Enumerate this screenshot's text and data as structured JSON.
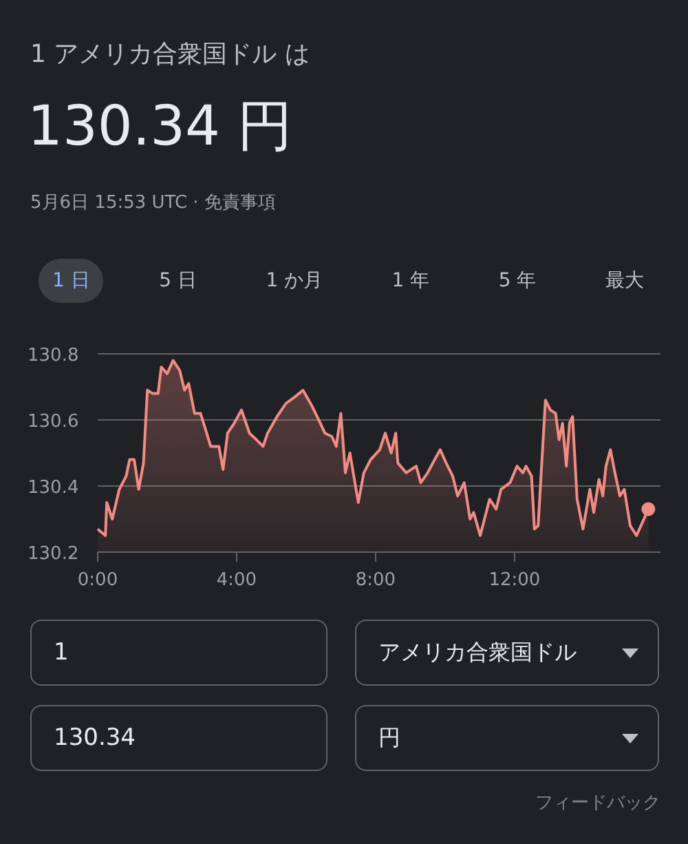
{
  "header": {
    "title": "1 アメリカ合衆国ドル は",
    "rate": "130.34 円",
    "timestamp": "5月6日 15:53 UTC · ",
    "disclaimer": "免責事項"
  },
  "ranges": [
    {
      "label": "1 日",
      "selected": true
    },
    {
      "label": "5 日",
      "selected": false
    },
    {
      "label": "1 か月",
      "selected": false
    },
    {
      "label": "1 年",
      "selected": false
    },
    {
      "label": "5 年",
      "selected": false
    },
    {
      "label": "最大",
      "selected": false
    }
  ],
  "chart": {
    "chart_data": {
      "type": "area",
      "xlim": [
        0,
        16.2
      ],
      "ylim": [
        130.2,
        130.8
      ],
      "xticks": [
        {
          "value": 0,
          "label": "0:00"
        },
        {
          "value": 4,
          "label": "4:00"
        },
        {
          "value": 8,
          "label": "8:00"
        },
        {
          "value": 12,
          "label": "12:00"
        }
      ],
      "yticks": [
        {
          "value": 130.2,
          "label": "130.2"
        },
        {
          "value": 130.4,
          "label": "130.4"
        },
        {
          "value": 130.6,
          "label": "130.6"
        },
        {
          "value": 130.8,
          "label": "130.8"
        }
      ],
      "x": [
        0,
        0.22,
        0.26,
        0.42,
        0.62,
        0.82,
        0.92,
        1.05,
        1.18,
        1.32,
        1.43,
        1.58,
        1.74,
        1.83,
        2.0,
        2.17,
        2.36,
        2.5,
        2.62,
        2.79,
        2.96,
        3.05,
        3.25,
        3.49,
        3.61,
        3.74,
        3.93,
        4.14,
        4.37,
        4.57,
        4.76,
        4.89,
        5.16,
        5.42,
        5.68,
        5.91,
        6.18,
        6.41,
        6.54,
        6.74,
        6.87,
        7.0,
        7.13,
        7.26,
        7.5,
        7.66,
        7.86,
        8.12,
        8.28,
        8.45,
        8.58,
        8.64,
        8.88,
        9.17,
        9.3,
        9.5,
        9.7,
        9.86,
        10.03,
        10.22,
        10.36,
        10.55,
        10.72,
        10.82,
        11.01,
        11.28,
        11.47,
        11.61,
        11.87,
        12.07,
        12.24,
        12.33,
        12.49,
        12.57,
        12.68,
        12.89,
        13.03,
        13.18,
        13.28,
        13.38,
        13.49,
        13.58,
        13.67,
        13.8,
        13.97,
        14.17,
        14.28,
        14.43,
        14.54,
        14.63,
        14.76,
        14.89,
        15.03,
        15.16,
        15.33,
        15.51,
        15.85
      ],
      "series": [
        {
          "color": "#f28b82",
          "values": [
            130.27,
            130.25,
            130.35,
            130.3,
            130.39,
            130.43,
            130.48,
            130.48,
            130.39,
            130.47,
            130.69,
            130.68,
            130.68,
            130.76,
            130.74,
            130.78,
            130.75,
            130.69,
            130.71,
            130.62,
            130.62,
            130.59,
            130.52,
            130.52,
            130.45,
            130.56,
            130.59,
            130.63,
            130.56,
            130.54,
            130.52,
            130.56,
            130.61,
            130.65,
            130.67,
            130.69,
            130.64,
            130.59,
            130.56,
            130.55,
            130.52,
            130.62,
            130.44,
            130.5,
            130.35,
            130.44,
            130.48,
            130.51,
            130.56,
            130.5,
            130.56,
            130.47,
            130.44,
            130.46,
            130.41,
            130.44,
            130.48,
            130.51,
            130.47,
            130.43,
            130.37,
            130.41,
            130.3,
            130.32,
            130.25,
            130.36,
            130.33,
            130.39,
            130.41,
            130.46,
            130.44,
            130.46,
            130.43,
            130.27,
            130.28,
            130.66,
            130.63,
            130.62,
            130.54,
            130.59,
            130.46,
            130.59,
            130.61,
            130.36,
            130.27,
            130.39,
            130.32,
            130.42,
            130.37,
            130.46,
            130.51,
            130.44,
            130.37,
            130.39,
            130.28,
            130.25,
            130.33
          ]
        }
      ]
    }
  },
  "converter": {
    "rows": [
      {
        "amount": "1",
        "currency": "アメリカ合衆国ドル"
      },
      {
        "amount": "130.34",
        "currency": "円"
      }
    ]
  },
  "feedback": "フィードバック"
}
